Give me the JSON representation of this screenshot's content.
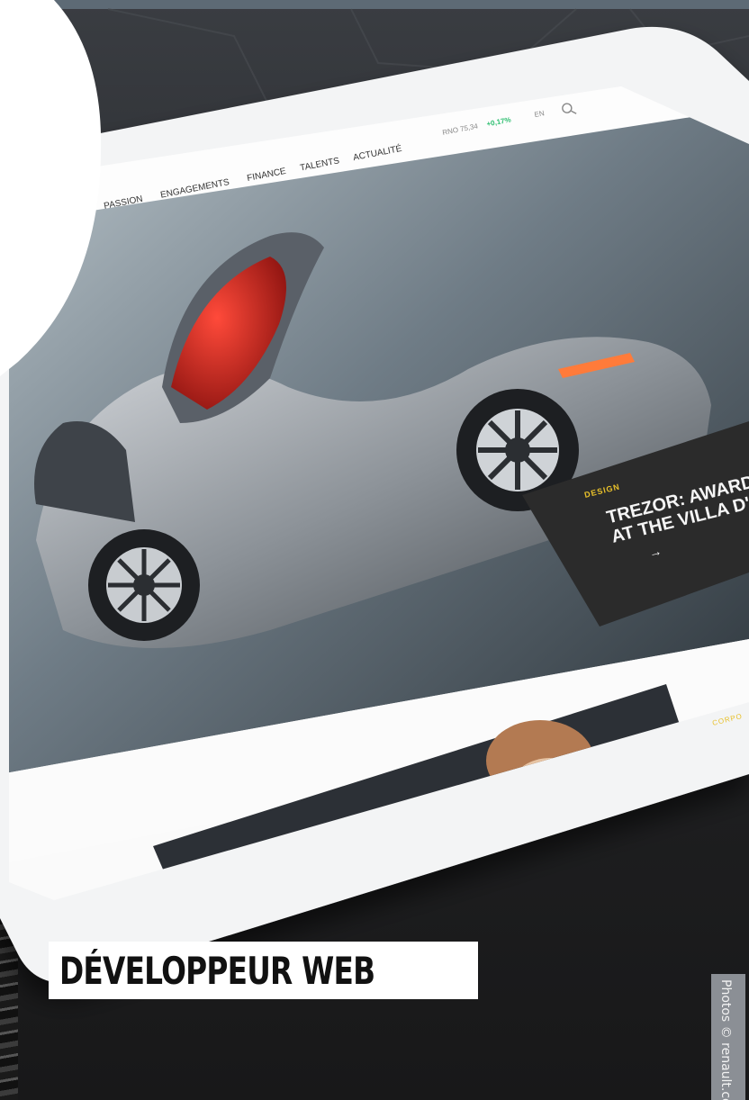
{
  "site": {
    "nav_items": [
      "PASSION",
      "ENGAGEMENTS",
      "FINANCE",
      "TALENTS",
      "ACTUALITÉ"
    ],
    "stock": {
      "ticker": "RNO 75,34",
      "change": "+0,17%"
    },
    "language": "EN"
  },
  "hero_card": {
    "category": "DESIGN",
    "headline_line1": "TREZOR: AWARDED F",
    "headline_line2": "AT THE VILLA D'ES",
    "arrow": "→"
  },
  "secondary": {
    "category": "CORPO"
  },
  "caption": "DÉVELOPPEUR WEB",
  "credit": "Photos © renault.com",
  "colors": {
    "accent_yellow": "#e8c02a",
    "stock_green": "#2fbf71",
    "card_dark": "#2b2b2b",
    "car_red": "#c3201c"
  },
  "icons": {
    "search": "search-icon",
    "arrow": "arrow-right-icon"
  }
}
